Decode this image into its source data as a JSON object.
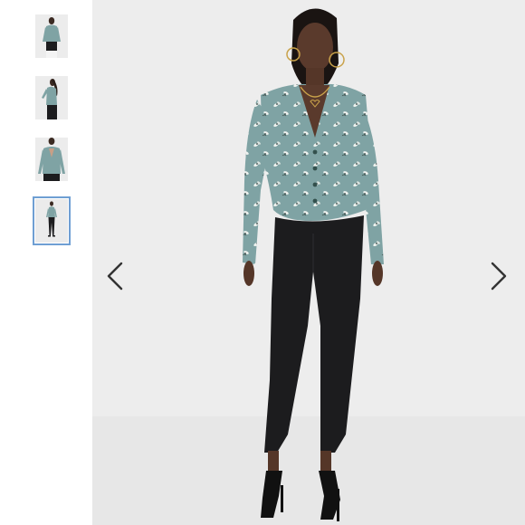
{
  "gallery": {
    "active_index": 3,
    "thumbnails": [
      {
        "view": "front-close"
      },
      {
        "view": "side"
      },
      {
        "view": "back"
      },
      {
        "view": "full-length"
      }
    ],
    "prev_icon": "chevron-left-icon",
    "next_icon": "chevron-right-icon"
  },
  "product_image": {
    "top_color": "#7fa3a4",
    "pants_color": "#1c1c1e",
    "background_color": "#ededed"
  }
}
